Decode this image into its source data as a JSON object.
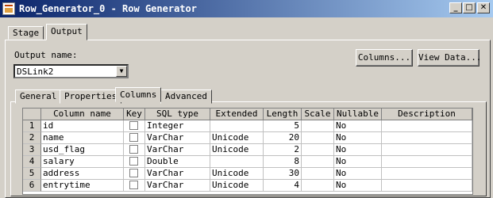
{
  "window": {
    "title": "Row_Generator_0 - Row Generator",
    "minimize": "_",
    "maximize": "□",
    "close": "✕"
  },
  "tabs": [
    {
      "label": "Stage"
    },
    {
      "label": "Output"
    }
  ],
  "output_name": {
    "label": "Output name:",
    "value": "DSLink2"
  },
  "buttons": {
    "columns": "Columns...",
    "view_data": "View Data..."
  },
  "sub_tabs": [
    {
      "label": "General"
    },
    {
      "label": "Properties"
    },
    {
      "label": "Columns"
    },
    {
      "label": "Advanced"
    }
  ],
  "grid": {
    "headers": [
      "Column name",
      "Key",
      "SQL type",
      "Extended",
      "Length",
      "Scale",
      "Nullable",
      "Description"
    ],
    "rows": [
      {
        "num": "1",
        "name": "id",
        "key": false,
        "sql_type": "Integer",
        "extended": "",
        "length": "5",
        "scale": "",
        "nullable": "No",
        "description": ""
      },
      {
        "num": "2",
        "name": "name",
        "key": false,
        "sql_type": "VarChar",
        "extended": "Unicode",
        "length": "20",
        "scale": "",
        "nullable": "No",
        "description": ""
      },
      {
        "num": "3",
        "name": "usd_flag",
        "key": false,
        "sql_type": "VarChar",
        "extended": "Unicode",
        "length": "2",
        "scale": "",
        "nullable": "No",
        "description": ""
      },
      {
        "num": "4",
        "name": "salary",
        "key": false,
        "sql_type": "Double",
        "extended": "",
        "length": "8",
        "scale": "",
        "nullable": "No",
        "description": ""
      },
      {
        "num": "5",
        "name": "address",
        "key": false,
        "sql_type": "VarChar",
        "extended": "Unicode",
        "length": "30",
        "scale": "",
        "nullable": "No",
        "description": ""
      },
      {
        "num": "6",
        "name": "entrytime",
        "key": false,
        "sql_type": "VarChar",
        "extended": "Unicode",
        "length": "4",
        "scale": "",
        "nullable": "No",
        "description": ""
      }
    ]
  }
}
